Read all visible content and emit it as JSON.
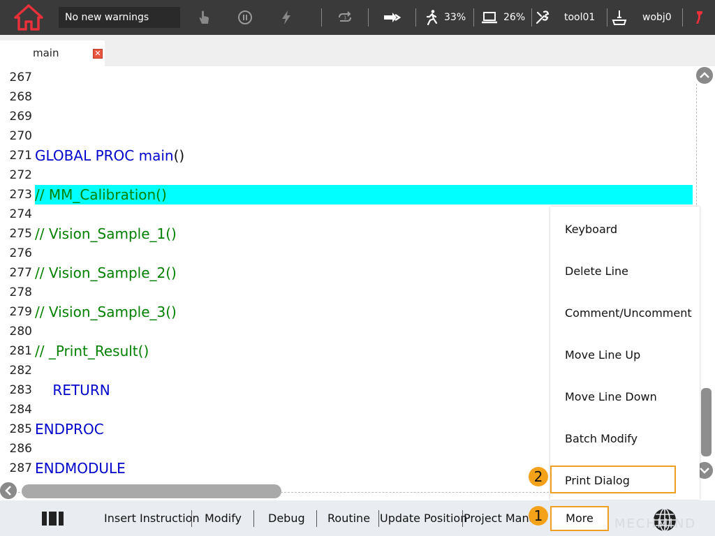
{
  "status_bar": {
    "warning_text": "No new warnings",
    "speed_percent": "33%",
    "load_percent": "26%",
    "tool": "tool01",
    "wobj": "wobj0",
    "colors": {
      "bar": "#3a3a3a",
      "home_icon": "#e8303a",
      "accent": "#e8303a"
    }
  },
  "tabs": [
    {
      "label": "main"
    }
  ],
  "editor": {
    "lines": [
      {
        "num": "267",
        "segments": []
      },
      {
        "num": "268",
        "segments": []
      },
      {
        "num": "269",
        "segments": []
      },
      {
        "num": "270",
        "segments": []
      },
      {
        "num": "271",
        "segments": [
          {
            "text": "GLOBAL PROC main",
            "kind": "kw"
          },
          {
            "text": "()",
            "kind": "pn"
          }
        ]
      },
      {
        "num": "272",
        "segments": []
      },
      {
        "num": "273",
        "segments": [
          {
            "text": "// MM_Calibration()",
            "kind": "cm"
          }
        ],
        "highlight": true
      },
      {
        "num": "274",
        "segments": []
      },
      {
        "num": "275",
        "segments": [
          {
            "text": "// Vision_Sample_1()",
            "kind": "cm"
          }
        ]
      },
      {
        "num": "276",
        "segments": []
      },
      {
        "num": "277",
        "segments": [
          {
            "text": "// Vision_Sample_2()",
            "kind": "cm"
          }
        ]
      },
      {
        "num": "278",
        "segments": []
      },
      {
        "num": "279",
        "segments": [
          {
            "text": "// Vision_Sample_3()",
            "kind": "cm"
          }
        ]
      },
      {
        "num": "280",
        "segments": []
      },
      {
        "num": "281",
        "segments": [
          {
            "text": "// _Print_Result()",
            "kind": "cm"
          }
        ]
      },
      {
        "num": "282",
        "segments": []
      },
      {
        "num": "283",
        "segments": [
          {
            "text": "    RETURN",
            "kind": "kw"
          }
        ]
      },
      {
        "num": "284",
        "segments": []
      },
      {
        "num": "285",
        "segments": [
          {
            "text": "ENDPROC",
            "kind": "kw"
          }
        ]
      },
      {
        "num": "286",
        "segments": []
      },
      {
        "num": "287",
        "segments": [
          {
            "text": "ENDMODULE",
            "kind": "kw"
          }
        ]
      }
    ],
    "colors": {
      "keyword": "#0000cc",
      "comment": "#008000",
      "highlight": "#00ffff"
    }
  },
  "context_menu": {
    "items": [
      {
        "label": "Keyboard"
      },
      {
        "label": "Delete Line"
      },
      {
        "label": "Comment/Uncomment"
      },
      {
        "label": "Move Line Up"
      },
      {
        "label": "Move Line Down"
      },
      {
        "label": "Batch Modify"
      },
      {
        "label": "Print Dialog"
      }
    ]
  },
  "toolbar": {
    "insert": "Insert Instruction",
    "modify": "Modify",
    "debug": "Debug",
    "routine": "Routine",
    "update_position": "Update Position",
    "project_manager": "Project Manag",
    "more": "More"
  },
  "annotations": {
    "step1": "1",
    "step2": "2",
    "color": "#f5a21b"
  },
  "watermark": "MECHMIND"
}
